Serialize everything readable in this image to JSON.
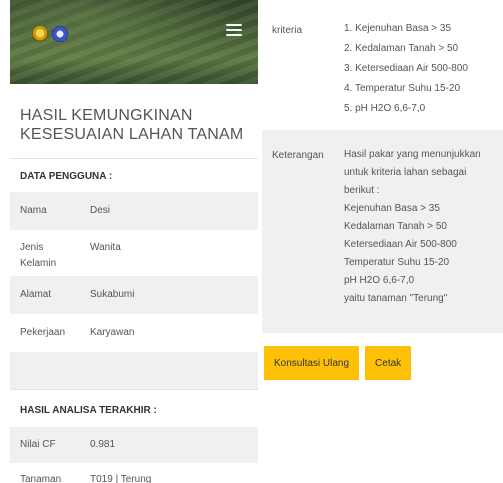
{
  "colors": {
    "accent": "#ffc107",
    "panel_grey": "#f0f0f0",
    "hero_green": "#4a6236"
  },
  "header": {
    "logos": [
      "university-emblem-icon",
      "institution-emblem-icon"
    ],
    "menu_icon": "hamburger-menu-icon"
  },
  "page_title": "HASIL KEMUNGKINAN KESESUAIAN LAHAN TANAM",
  "user_section": {
    "heading": "DATA PENGGUNA :",
    "rows": [
      {
        "label": "Nama",
        "value": "Desi"
      },
      {
        "label": "Jenis Kelamin",
        "value": "Wanita"
      },
      {
        "label": "Alamat",
        "value": "Sukabumi"
      },
      {
        "label": "Pekerjaan",
        "value": "Karyawan"
      }
    ]
  },
  "analysis_section": {
    "heading": "HASIL ANALISA TERAKHIR :",
    "rows": [
      {
        "label": "Nilai CF",
        "value": "0.981"
      },
      {
        "label": "Tanaman",
        "value": "T019 | Terung"
      }
    ]
  },
  "kriteria": {
    "label": "kriteria",
    "items": [
      "1. Kejenuhan Basa > 35",
      "2. Kedalaman Tanah > 50",
      "3. Ketersediaan Air 500-800",
      "4. Temperatur Suhu 15-20",
      "5. pH H2O 6,6-7,0"
    ]
  },
  "keterangan": {
    "label": "Keterangan",
    "lines": [
      "Hasil pakar yang menunjukkan",
      "untuk kriteria lahan sebagai",
      "berikut :",
      "Kejenuhan Basa > 35",
      "Kedalaman Tanah > 50",
      "Ketersediaan Air 500-800",
      "Temperatur Suhu 15-20",
      "pH H2O 6,6-7,0",
      "yaitu tanaman \"Terung\""
    ]
  },
  "buttons": {
    "consult_again": "Konsultasi Ulang",
    "print": "Cetak"
  }
}
